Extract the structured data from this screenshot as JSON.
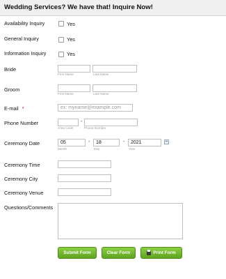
{
  "form": {
    "title": "Wedding Services? We have that! Inquire Now!",
    "availability": {
      "label": "Availability Inquiry",
      "option": "Yes"
    },
    "general": {
      "label": "General Inquiry",
      "option": "Yes"
    },
    "information": {
      "label": "Information Inquiry",
      "option": "Yes"
    },
    "bride": {
      "label": "Bride",
      "first_sub": "First Name",
      "last_sub": "Last Name",
      "first_value": "",
      "last_value": ""
    },
    "groom": {
      "label": "Groom",
      "first_sub": "First Name",
      "last_sub": "Last Name",
      "first_value": "",
      "last_value": ""
    },
    "email": {
      "label": "E-mail",
      "required_mark": "*",
      "placeholder": "ex: myname@example.com",
      "value": ""
    },
    "phone": {
      "label": "Phone Number",
      "area_sub": "Area Code",
      "number_sub": "Phone Number",
      "separator": "-"
    },
    "date": {
      "label": "Ceremony Date",
      "month": "05",
      "day": "18",
      "year": "2021",
      "month_sub": "Month",
      "day_sub": "Day",
      "year_sub": "Year",
      "separator": "-"
    },
    "time": {
      "label": "Ceremony Time",
      "value": ""
    },
    "city": {
      "label": "Ceremony City",
      "value": ""
    },
    "venue": {
      "label": "Ceremony Venue",
      "value": ""
    },
    "questions": {
      "label": "Questions/Comments",
      "value": ""
    },
    "buttons": {
      "submit": "Submit Form",
      "clear": "Clear Form",
      "print": "Print Form"
    }
  },
  "colors": {
    "button_green": "#6fb52b",
    "required": "#cc0000",
    "header_bg": "#f0f0f0"
  }
}
